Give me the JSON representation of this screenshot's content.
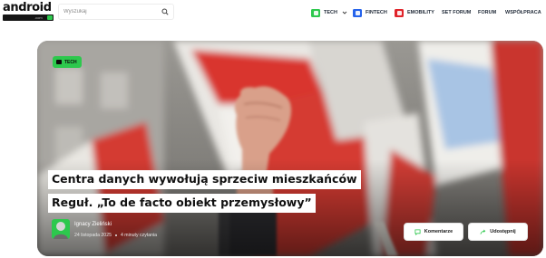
{
  "brand": {
    "logo_text": "android",
    "logo_sub": ".com"
  },
  "search": {
    "placeholder": "Wyszukaj",
    "icon": "search-icon"
  },
  "nav": {
    "items": [
      {
        "label": "TECH",
        "badge_color": "#2dc84d",
        "icon": "tech-badge-icon",
        "dropdown": true
      },
      {
        "label": "FINTECH",
        "badge_color": "#2563eb",
        "icon": "fintech-badge-icon"
      },
      {
        "label": "EMOBILITY",
        "badge_color": "#e0242a",
        "icon": "emobility-badge-icon"
      },
      {
        "label": "SET FORUM"
      },
      {
        "label": "FORUM"
      },
      {
        "label": "WSPÓŁPRACA"
      }
    ]
  },
  "article": {
    "category": "TECH",
    "title_line1": "Centra danych wywołują sprzeciw mieszkańców",
    "title_line2": "Reguł. „To de facto obiekt przemysłowy”",
    "author": "Ignacy Zieliński",
    "date": "24 listopada 2025",
    "reading_time": "4 minuty czytania"
  },
  "actions": {
    "comments_label": "Komentarze",
    "share_label": "Udostępnij"
  },
  "colors": {
    "accent": "#2dc84d",
    "fintech": "#2563eb",
    "emobility": "#e0242a",
    "text": "#111111"
  }
}
